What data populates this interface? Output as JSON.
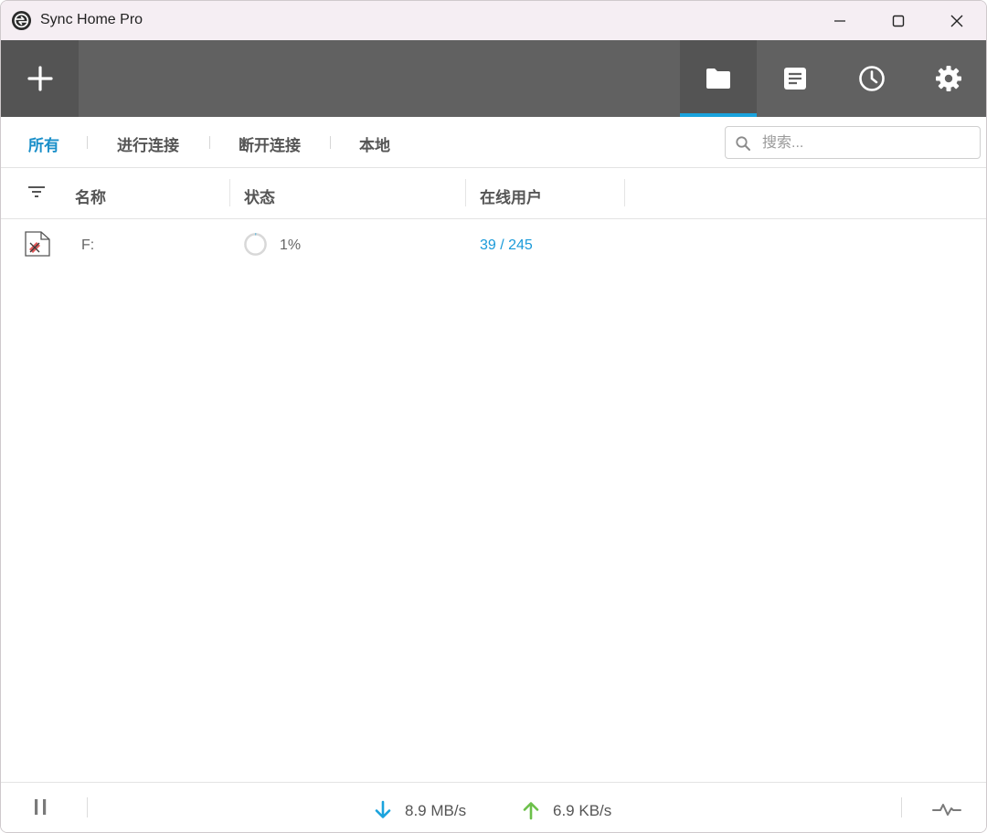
{
  "window": {
    "title": "Sync Home Pro"
  },
  "toolbar": {
    "add_icon": "plus-icon",
    "buttons": [
      {
        "icon": "folder-icon",
        "active": true
      },
      {
        "icon": "document-icon",
        "active": false
      },
      {
        "icon": "clock-icon",
        "active": false
      },
      {
        "icon": "gear-icon",
        "active": false
      }
    ],
    "accent_color": "#1aa3dd"
  },
  "filters": {
    "tabs": [
      "所有",
      "进行连接",
      "断开连接",
      "本地"
    ],
    "active_tab": "所有"
  },
  "search": {
    "placeholder": "搜索...",
    "value": ""
  },
  "columns": {
    "name": "名称",
    "status": "状态",
    "peers": "在线用户"
  },
  "rows": [
    {
      "icon": "folder-error-icon",
      "name": "F:",
      "status_percent": "1%",
      "peers": "39 / 245"
    }
  ],
  "statusbar": {
    "download_speed": "8.9 MB/s",
    "upload_speed": "6.9 KB/s",
    "download_color": "#1aa3dd",
    "upload_color": "#6cc04a"
  }
}
